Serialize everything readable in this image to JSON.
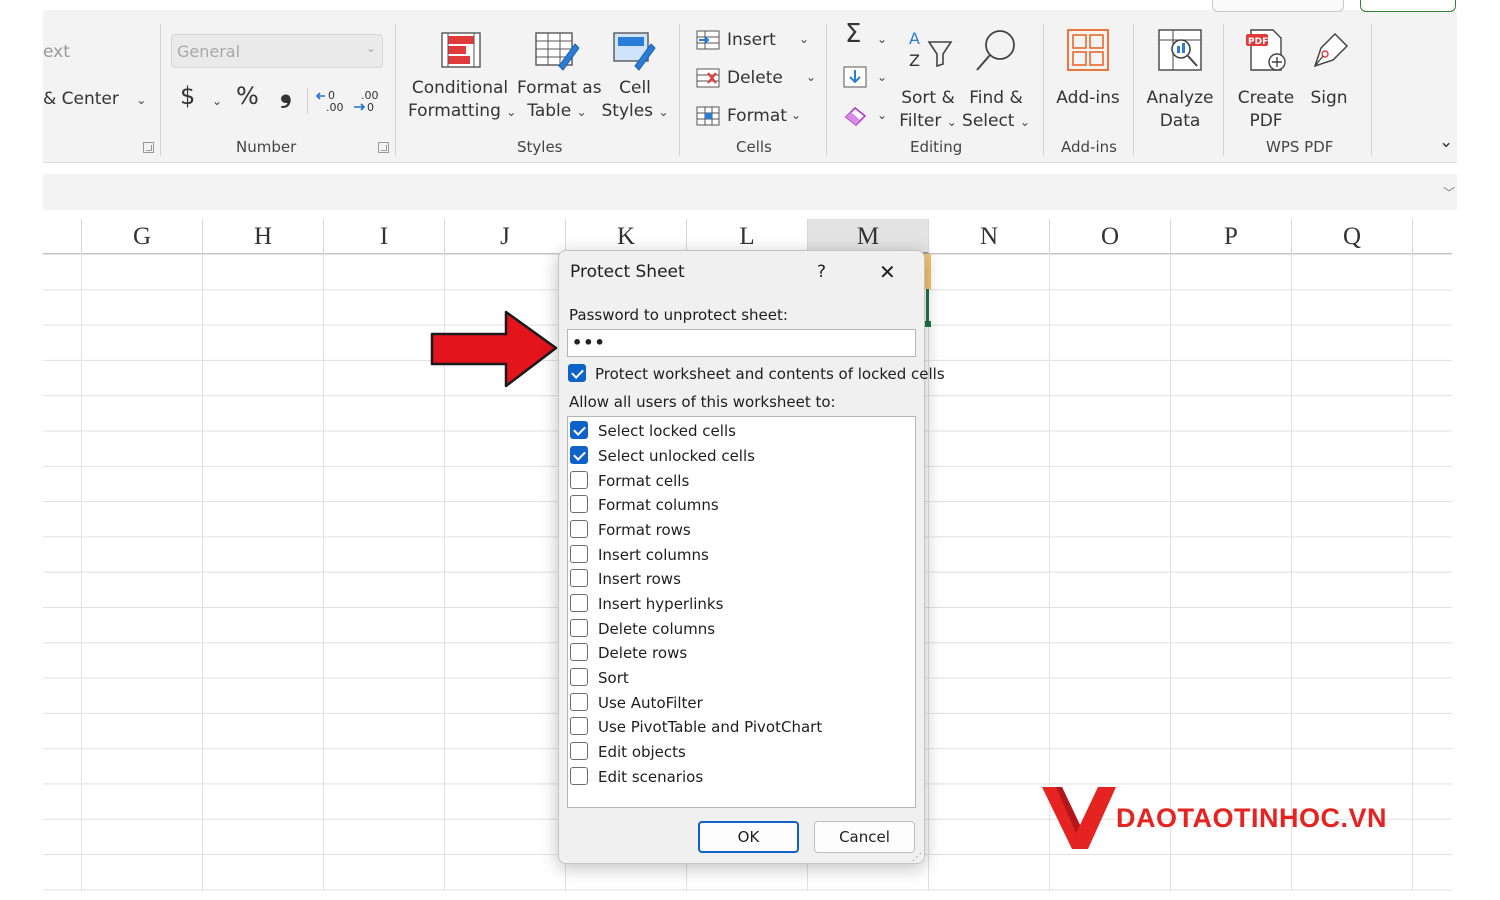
{
  "ribbon": {
    "alignment": {
      "text_partial": "ext",
      "merge_label": "& Center"
    },
    "number": {
      "format_value": "General",
      "currency_symbol": "$",
      "percent_symbol": "%",
      "comma_symbol": "❟",
      "inc_decimal_label": "←0 .00",
      "dec_decimal_label": ".00 →0",
      "group_label": "Number"
    },
    "styles": {
      "conditional_formatting": [
        "Conditional",
        "Formatting"
      ],
      "format_as_table": [
        "Format as",
        "Table"
      ],
      "cell_styles": [
        "Cell",
        "Styles"
      ],
      "group_label": "Styles"
    },
    "cells": {
      "insert": "Insert",
      "delete": "Delete",
      "format": "Format",
      "group_label": "Cells"
    },
    "editing": {
      "sort_filter": [
        "Sort &",
        "Filter"
      ],
      "find_select": [
        "Find &",
        "Select"
      ],
      "group_label": "Editing"
    },
    "addins": {
      "button": "Add-ins",
      "group_label": "Add-ins"
    },
    "analyze": {
      "button": [
        "Analyze",
        "Data"
      ]
    },
    "wps_pdf": {
      "create_pdf": [
        "Create",
        "PDF"
      ],
      "sign": "Sign",
      "group_label": "WPS PDF",
      "pdf_badge": "PDF"
    }
  },
  "grid": {
    "columns": [
      "G",
      "H",
      "I",
      "J",
      "K",
      "L",
      "M",
      "N",
      "O",
      "P",
      "Q"
    ],
    "selected_column": "M"
  },
  "dialog": {
    "title": "Protect Sheet",
    "help": "?",
    "close": "✕",
    "password_label": "Password to unprotect sheet:",
    "password_value": "•••",
    "protect_label": "Protect worksheet and contents of locked cells",
    "protect_checked": true,
    "allow_label": "Allow all users of this worksheet to:",
    "permissions": [
      {
        "label": "Select locked cells",
        "checked": true
      },
      {
        "label": "Select unlocked cells",
        "checked": true
      },
      {
        "label": "Format cells",
        "checked": false
      },
      {
        "label": "Format columns",
        "checked": false
      },
      {
        "label": "Format rows",
        "checked": false
      },
      {
        "label": "Insert columns",
        "checked": false
      },
      {
        "label": "Insert rows",
        "checked": false
      },
      {
        "label": "Insert hyperlinks",
        "checked": false
      },
      {
        "label": "Delete columns",
        "checked": false
      },
      {
        "label": "Delete rows",
        "checked": false
      },
      {
        "label": "Sort",
        "checked": false
      },
      {
        "label": "Use AutoFilter",
        "checked": false
      },
      {
        "label": "Use PivotTable and PivotChart",
        "checked": false
      },
      {
        "label": "Edit objects",
        "checked": false
      },
      {
        "label": "Edit scenarios",
        "checked": false
      }
    ],
    "ok_label": "OK",
    "cancel_label": "Cancel"
  },
  "watermark": {
    "text": "DAOTAOTINHOC.VN",
    "color": "#e52421"
  },
  "annotation": {
    "arrow_color": "#e3141b"
  }
}
